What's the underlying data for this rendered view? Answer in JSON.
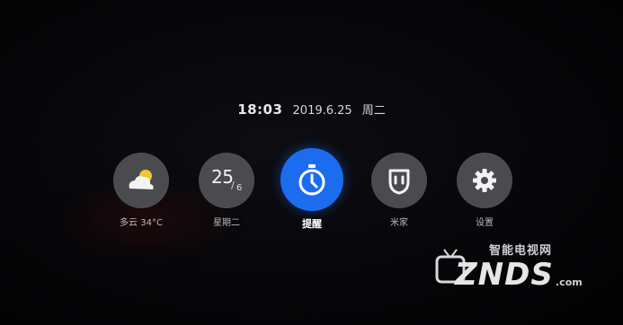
{
  "status": {
    "time": "18:03",
    "date": "2019.6.25",
    "weekday": "周二"
  },
  "tiles": [
    {
      "id": "weather",
      "label": "多云 34°C",
      "icon": "cloud-sun-icon",
      "active": false
    },
    {
      "id": "date",
      "label": "星期二",
      "icon": "calendar-date",
      "day": "25",
      "month": "6",
      "active": false
    },
    {
      "id": "reminder",
      "label": "提醒",
      "icon": "stopwatch-icon",
      "active": true
    },
    {
      "id": "mijia",
      "label": "米家",
      "icon": "mijia-logo-icon",
      "active": false
    },
    {
      "id": "settings",
      "label": "设置",
      "icon": "gear-icon",
      "active": false
    }
  ],
  "watermark": {
    "chinese": "智能电视网",
    "brand": "ZNDS",
    "domain": ".com"
  },
  "colors": {
    "background": "#060608",
    "tile": "#4a4b4f",
    "accent": "#1c6cf0"
  }
}
